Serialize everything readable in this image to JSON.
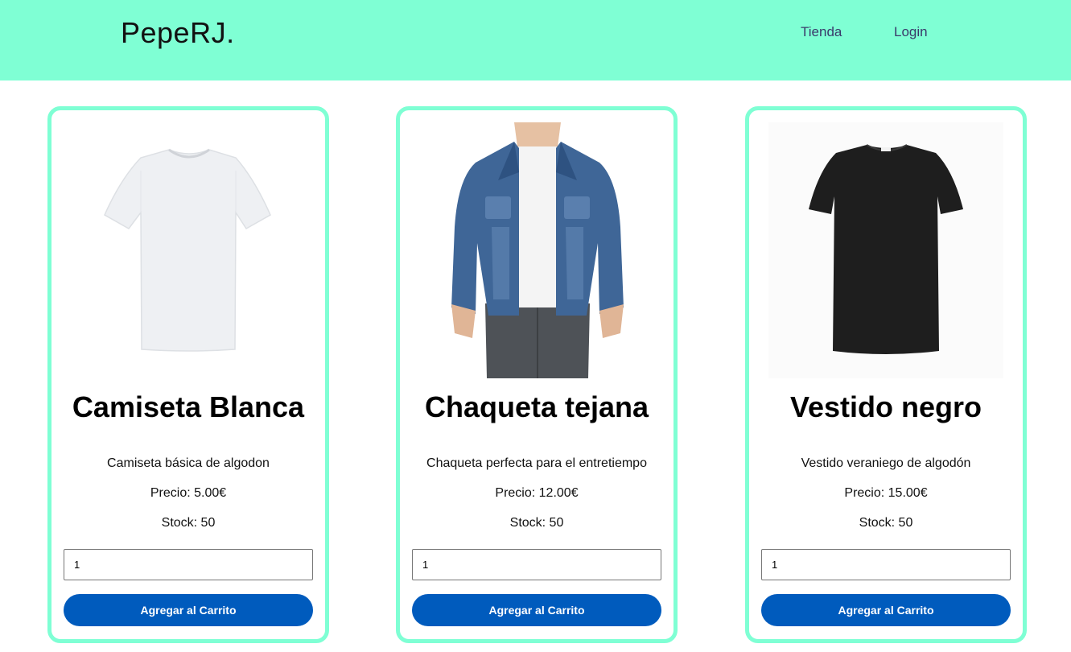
{
  "header": {
    "brand": "PepeRJ.",
    "nav": [
      {
        "label": "Tienda"
      },
      {
        "label": "Login"
      }
    ],
    "background": "#7fffd4"
  },
  "products": [
    {
      "title": "Camiseta Blanca",
      "description": "Camiseta básica de algodon",
      "price": "Precio: 5.00€",
      "stock": "Stock: 50",
      "quantity": "1",
      "button": "Agregar al Carrito",
      "image": "white-tshirt-image"
    },
    {
      "title": "Chaqueta tejana",
      "description": "Chaqueta perfecta para el entretiempo",
      "price": "Precio: 12.00€",
      "stock": "Stock: 50",
      "quantity": "1",
      "button": "Agregar al Carrito",
      "image": "denim-jacket-image"
    },
    {
      "title": "Vestido negro",
      "description": "Vestido veraniego de algodón",
      "price": "Precio: 15.00€",
      "stock": "Stock: 50",
      "quantity": "1",
      "button": "Agregar al Carrito",
      "image": "black-dress-image"
    }
  ],
  "colors": {
    "accent": "#7fffd4",
    "button": "#005bbd"
  }
}
